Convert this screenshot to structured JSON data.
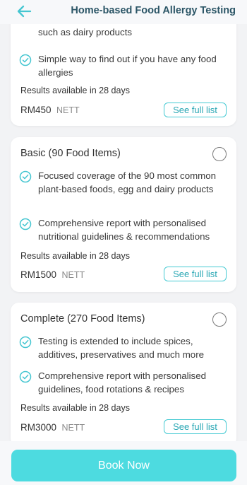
{
  "header": {
    "title": "Home-based Food Allergy Testing",
    "back_icon": "back-arrow-icon",
    "accent": "#45c6d1"
  },
  "plans": [
    {
      "title": "",
      "features": [
        "such as dairy products",
        "Simple way to find out if you have any food allergies"
      ],
      "results": "Results available in 28 days",
      "price": "RM450",
      "nett": "NETT",
      "see_full": "See full list"
    },
    {
      "title": "Basic (90 Food Items)",
      "features": [
        "Focused coverage of the 90 most common plant-based foods, egg and dairy products",
        "Comprehensive report with personalised nutritional guidelines & recommendations"
      ],
      "results": "Results available in 28 days",
      "price": "RM1500",
      "nett": "NETT",
      "see_full": "See full list"
    },
    {
      "title": "Complete (270 Food Items)",
      "features": [
        "Testing is extended to include spices, additives, preservatives and much more",
        "Comprehensive report with personalised guidelines, food rotations & recipes"
      ],
      "results": "Results available in 28 days",
      "price": "RM3000",
      "nett": "NETT",
      "see_full": "See full list"
    }
  ],
  "footer": {
    "book_label": "Book Now",
    "button_color": "#4ddbe0"
  }
}
